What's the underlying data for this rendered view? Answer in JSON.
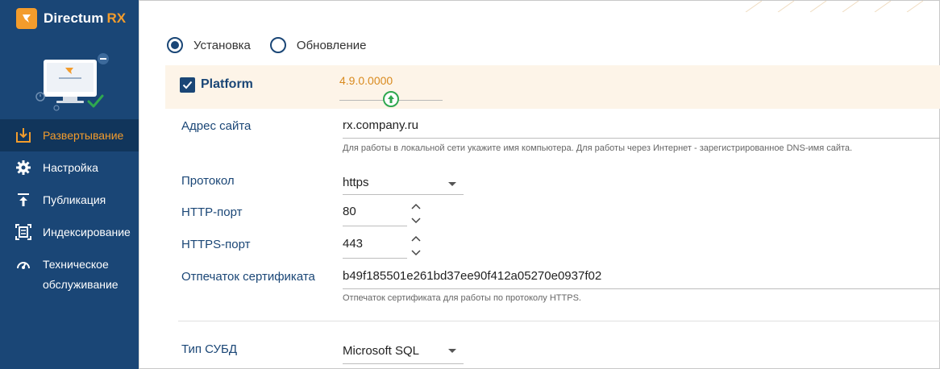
{
  "app": {
    "name": "Directum",
    "name_accent": "RX"
  },
  "sidebar": {
    "items": [
      {
        "label": "Развертывание",
        "icon": "deploy-icon",
        "active": true
      },
      {
        "label": "Настройка",
        "icon": "gear-icon",
        "active": false
      },
      {
        "label": "Публикация",
        "icon": "publish-icon",
        "active": false
      },
      {
        "label": "Индексирование",
        "icon": "index-icon",
        "active": false
      },
      {
        "label": "Техническое",
        "label2": "обслуживание",
        "icon": "maintenance-icon",
        "active": false
      }
    ]
  },
  "mode": {
    "options": [
      "Установка",
      "Обновление"
    ],
    "selected": "Установка"
  },
  "platform": {
    "label": "Platform",
    "checked": true,
    "version": "4.9.0.0000"
  },
  "form": {
    "site_address": {
      "label": "Адрес сайта",
      "value": "rx.company.ru",
      "hint": "Для работы в локальной сети укажите имя компьютера. Для работы через Интернет - зарегистрированное DNS-имя сайта."
    },
    "protocol": {
      "label": "Протокол",
      "value": "https"
    },
    "http_port": {
      "label": "HTTP-порт",
      "value": "80"
    },
    "https_port": {
      "label": "HTTPS-порт",
      "value": "443"
    },
    "cert_thumbprint": {
      "label": "Отпечаток сертификата",
      "value": "b49f185501e261bd37ee90f412a05270e0937f02",
      "hint": "Отпечаток сертификата для работы по протоколу HTTPS."
    },
    "dbms_type": {
      "label": "Тип СУБД",
      "value": "Microsoft SQL"
    }
  },
  "colors": {
    "sidebar": "#1a4676",
    "accent": "#f39c2c",
    "band": "#fdf4e8",
    "success": "#2fa84f"
  }
}
